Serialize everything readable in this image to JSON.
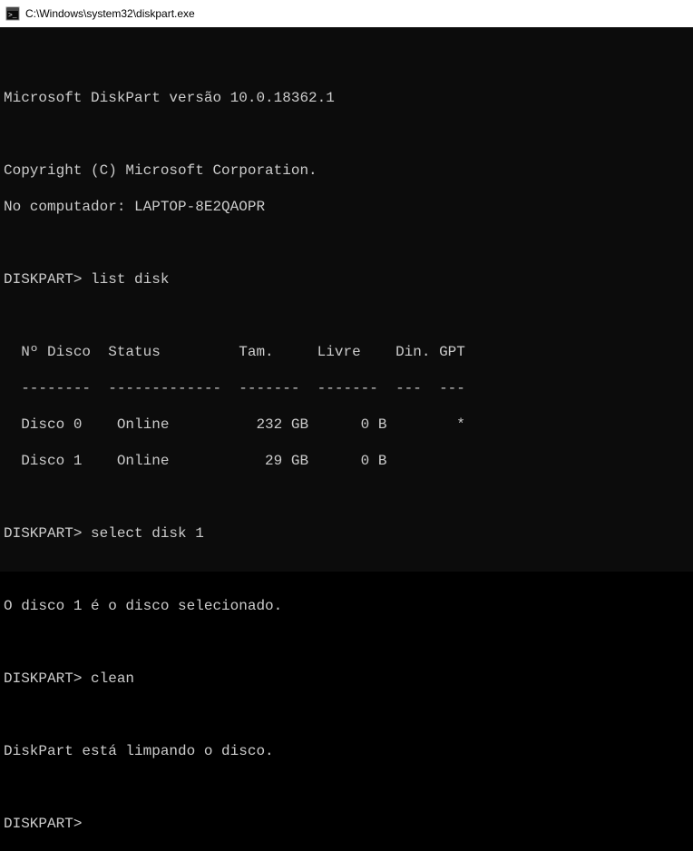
{
  "window": {
    "title": "C:\\Windows\\system32\\diskpart.exe"
  },
  "terminal": {
    "intro1": "Microsoft DiskPart versão 10.0.18362.1",
    "intro2": "Copyright (C) Microsoft Corporation.",
    "intro3": "No computador: LAPTOP-8E2QAOPR",
    "cmd1": "DISKPART> list disk",
    "table_header": "  Nº Disco  Status         Tam.     Livre    Din. GPT",
    "table_sep": "  --------  -------------  -------  -------  ---  ---",
    "table_row0": "  Disco 0    Online          232 GB      0 B        *",
    "table_row1": "  Disco 1    Online           29 GB      0 B",
    "cmd2": "DISKPART> select disk 1",
    "resp1": "O disco 1 é o disco selecionado.",
    "cmd3": "DISKPART> clean",
    "resp2": "DiskPart está limpando o disco.",
    "cmd4": "DISKPART>"
  },
  "chart_data": {
    "type": "table",
    "title": "list disk",
    "columns": [
      "Nº Disco",
      "Status",
      "Tam.",
      "Livre",
      "Din.",
      "GPT"
    ],
    "rows": [
      {
        "num": "Disco 0",
        "status": "Online",
        "tam": "232 GB",
        "livre": "0 B",
        "din": "",
        "gpt": "*"
      },
      {
        "num": "Disco 1",
        "status": "Online",
        "tam": "29 GB",
        "livre": "0 B",
        "din": "",
        "gpt": ""
      }
    ]
  }
}
